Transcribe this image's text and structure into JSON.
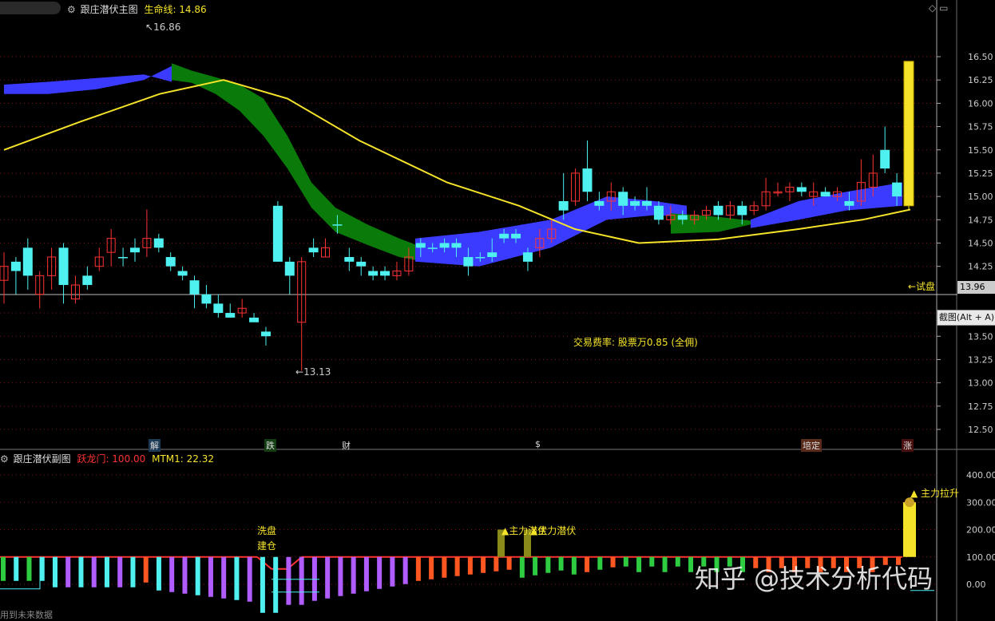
{
  "main_panel": {
    "title": "跟庄潜伏主图",
    "indicator_label": "生命线: 14.86",
    "high_marker": "16.86",
    "low_marker": "13.13",
    "fee_note": "交易费率: 股票万0.85 (全佣)",
    "test_label": "←试盘",
    "current_price_tag": "13.96",
    "screenshot_popup": "截图(Alt + A)",
    "signals": [
      {
        "label": "解",
        "color": "#5ac8fa"
      },
      {
        "label": "跌",
        "color": "#2ecc40"
      },
      {
        "label": "财",
        "color": "#5ac8fa"
      },
      {
        "label": "$",
        "color": "#ff3333"
      },
      {
        "label": "培定",
        "color": "#ff6a3a"
      },
      {
        "label": "涨",
        "color": "#ff3333"
      }
    ]
  },
  "sub_panel": {
    "title": "跟庄潜伏副图",
    "label1": "跃龙门: 100.00",
    "label2": "MTM1: 22.32",
    "annotations": [
      "洗盘",
      "建仓",
      "▲主力潜伏",
      "▲主力潜伏",
      "▲ 主力拉升"
    ]
  },
  "footer_text": "用到未来数据",
  "watermark": "知乎 @技术分析代码",
  "colors": {
    "up": "#ff3333",
    "down": "#4ef0f0",
    "yellow": "#f5e32a",
    "green_band": "#0a7a0a",
    "blue_band": "#3b3bff",
    "purple": "#b05cff",
    "orange": "#ff5722",
    "green_bar": "#2ecc40"
  },
  "chart_data": [
    {
      "type": "candlestick",
      "title": "跟庄潜伏主图",
      "y_ticks": [
        16.5,
        16.25,
        16.0,
        15.75,
        15.5,
        15.25,
        15.0,
        14.75,
        14.5,
        14.25,
        13.75,
        13.5,
        13.25,
        13.0,
        12.75,
        12.5
      ],
      "ylim": [
        12.35,
        16.9
      ],
      "candles": [
        [
          14.1,
          14.25,
          13.85,
          14.4,
          "up"
        ],
        [
          14.3,
          14.2,
          13.95,
          14.35,
          "down"
        ],
        [
          14.45,
          14.15,
          14.0,
          14.55,
          "down"
        ],
        [
          13.95,
          14.15,
          13.8,
          14.2,
          "up"
        ],
        [
          14.15,
          14.35,
          14.0,
          14.45,
          "up"
        ],
        [
          14.45,
          14.05,
          13.85,
          14.5,
          "down"
        ],
        [
          13.9,
          14.05,
          13.85,
          14.15,
          "up"
        ],
        [
          14.15,
          14.05,
          14.0,
          14.25,
          "down"
        ],
        [
          14.25,
          14.35,
          14.2,
          14.45,
          "up"
        ],
        [
          14.4,
          14.55,
          14.25,
          14.65,
          "up"
        ],
        [
          14.35,
          14.35,
          14.25,
          14.45,
          "down"
        ],
        [
          14.45,
          14.4,
          14.3,
          14.55,
          "down"
        ],
        [
          14.45,
          14.55,
          14.35,
          14.86,
          "up"
        ],
        [
          14.55,
          14.45,
          14.4,
          14.6,
          "down"
        ],
        [
          14.35,
          14.25,
          14.2,
          14.4,
          "down"
        ],
        [
          14.2,
          14.15,
          14.1,
          14.25,
          "down"
        ],
        [
          14.1,
          13.95,
          13.8,
          14.15,
          "down"
        ],
        [
          13.95,
          13.85,
          13.8,
          14.05,
          "down"
        ],
        [
          13.85,
          13.75,
          13.7,
          13.95,
          "down"
        ],
        [
          13.75,
          13.7,
          13.7,
          13.85,
          "down"
        ],
        [
          13.75,
          13.8,
          13.7,
          13.9,
          "up"
        ],
        [
          13.7,
          13.65,
          13.65,
          13.75,
          "down"
        ],
        [
          13.55,
          13.5,
          13.4,
          13.6,
          "down"
        ],
        [
          14.9,
          14.3,
          14.3,
          14.95,
          "down"
        ],
        [
          14.3,
          14.15,
          13.95,
          14.35,
          "down"
        ],
        [
          13.65,
          14.3,
          13.13,
          14.35,
          "up"
        ],
        [
          14.45,
          14.4,
          14.35,
          14.55,
          "down"
        ],
        [
          14.35,
          14.45,
          14.35,
          14.55,
          "up"
        ],
        [
          14.7,
          14.7,
          14.6,
          14.8,
          "down"
        ],
        [
          14.35,
          14.3,
          14.2,
          14.45,
          "down"
        ],
        [
          14.3,
          14.25,
          14.15,
          14.35,
          "down"
        ],
        [
          14.2,
          14.15,
          14.1,
          14.25,
          "down"
        ],
        [
          14.2,
          14.15,
          14.1,
          14.25,
          "down"
        ],
        [
          14.15,
          14.2,
          14.1,
          14.3,
          "up"
        ],
        [
          14.2,
          14.35,
          14.15,
          14.45,
          "up"
        ],
        [
          14.5,
          14.45,
          14.35,
          14.55,
          "down"
        ],
        [
          14.45,
          14.45,
          14.4,
          14.5,
          "down"
        ],
        [
          14.5,
          14.45,
          14.4,
          14.55,
          "down"
        ],
        [
          14.5,
          14.45,
          14.35,
          14.55,
          "down"
        ],
        [
          14.35,
          14.25,
          14.15,
          14.45,
          "down"
        ],
        [
          14.35,
          14.35,
          14.3,
          14.4,
          "down"
        ],
        [
          14.4,
          14.35,
          14.3,
          14.55,
          "down"
        ],
        [
          14.6,
          14.55,
          14.5,
          14.65,
          "down"
        ],
        [
          14.6,
          14.55,
          14.5,
          14.65,
          "down"
        ],
        [
          14.4,
          14.3,
          14.2,
          14.45,
          "down"
        ],
        [
          14.45,
          14.55,
          14.35,
          14.65,
          "up"
        ],
        [
          14.55,
          14.65,
          14.5,
          14.75,
          "up"
        ],
        [
          14.95,
          14.85,
          14.75,
          15.25,
          "down"
        ],
        [
          14.95,
          15.25,
          14.9,
          15.3,
          "up"
        ],
        [
          15.3,
          15.05,
          14.95,
          15.6,
          "down"
        ],
        [
          14.95,
          14.9,
          14.85,
          15.05,
          "down"
        ],
        [
          14.95,
          15.05,
          14.85,
          15.15,
          "up"
        ],
        [
          15.05,
          14.9,
          14.8,
          15.1,
          "down"
        ],
        [
          14.9,
          14.95,
          14.85,
          15.0,
          "down"
        ],
        [
          14.95,
          14.9,
          14.85,
          15.1,
          "down"
        ],
        [
          14.9,
          14.75,
          14.7,
          14.95,
          "down"
        ],
        [
          14.75,
          14.8,
          14.7,
          14.9,
          "up"
        ],
        [
          14.8,
          14.75,
          14.7,
          14.85,
          "down"
        ],
        [
          14.75,
          14.8,
          14.7,
          14.85,
          "up"
        ],
        [
          14.8,
          14.85,
          14.75,
          14.9,
          "up"
        ],
        [
          14.9,
          14.8,
          14.75,
          14.95,
          "down"
        ],
        [
          14.8,
          14.9,
          14.75,
          14.95,
          "up"
        ],
        [
          14.9,
          14.8,
          14.7,
          14.95,
          "down"
        ],
        [
          14.85,
          14.9,
          14.8,
          14.95,
          "up"
        ],
        [
          14.9,
          15.05,
          14.85,
          15.2,
          "up"
        ],
        [
          15.05,
          15.05,
          15.0,
          15.15,
          "up"
        ],
        [
          15.05,
          15.1,
          14.95,
          15.15,
          "up"
        ],
        [
          15.1,
          15.05,
          15.0,
          15.15,
          "down"
        ],
        [
          15.0,
          15.05,
          14.9,
          15.15,
          "up"
        ],
        [
          15.05,
          15.0,
          15.0,
          15.1,
          "down"
        ],
        [
          15.0,
          15.05,
          14.95,
          15.1,
          "up"
        ],
        [
          14.95,
          14.9,
          14.85,
          15.05,
          "down"
        ],
        [
          14.95,
          15.15,
          14.9,
          15.4,
          "up"
        ],
        [
          15.1,
          15.25,
          15.0,
          15.45,
          "up"
        ],
        [
          15.5,
          15.3,
          15.25,
          15.75,
          "down"
        ],
        [
          15.15,
          15.0,
          14.9,
          15.25,
          "down"
        ],
        [
          14.9,
          16.45,
          14.85,
          16.45,
          "yellow"
        ]
      ]
    },
    {
      "type": "bar",
      "title": "跟庄潜伏副图",
      "y_ticks": [
        400.0,
        300.0,
        200.0,
        100.0,
        0.0
      ],
      "ylim": [
        -15,
        420
      ]
    }
  ]
}
